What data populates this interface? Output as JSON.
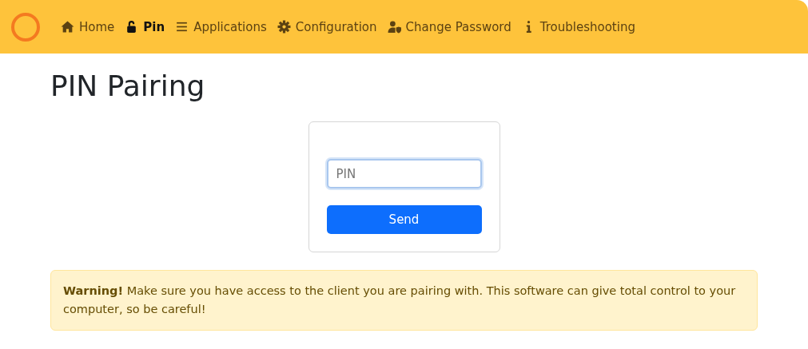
{
  "nav": {
    "items": [
      {
        "kind": "home",
        "label": "Home",
        "selected": false
      },
      {
        "kind": "lock",
        "label": "Pin",
        "selected": true
      },
      {
        "kind": "list",
        "label": "Applications",
        "selected": false
      },
      {
        "kind": "gear",
        "label": "Configuration",
        "selected": false
      },
      {
        "kind": "user",
        "label": "Change Password",
        "selected": false
      },
      {
        "kind": "info",
        "label": "Troubleshooting",
        "selected": false
      }
    ]
  },
  "title": "PIN Pairing",
  "form": {
    "pin": {
      "placeholder": "PIN"
    },
    "button": "Send"
  },
  "alert": {
    "text": "**Warning!** Make sure you have access to the client you are pairing with. This software can give total control to your computer, so be careful!"
  }
}
